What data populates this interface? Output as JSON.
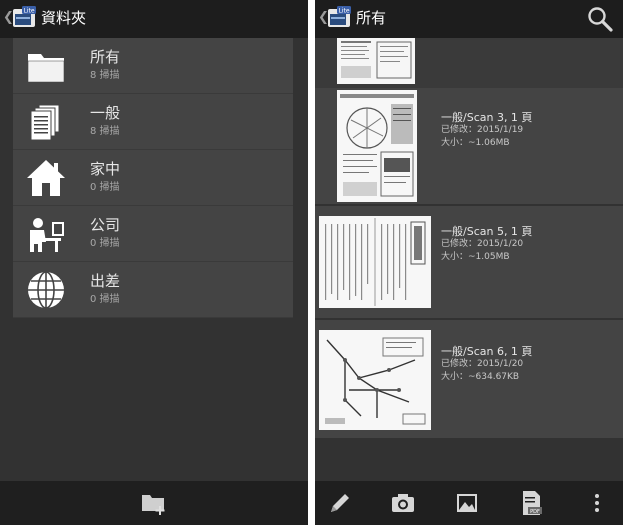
{
  "left_screen": {
    "title": "資料夾",
    "folders": [
      {
        "name": "所有",
        "count": "8 掃描",
        "icon": "folder-icon"
      },
      {
        "name": "一般",
        "count": "8 掃描",
        "icon": "documents-icon"
      },
      {
        "name": "家中",
        "count": "0 掃描",
        "icon": "home-icon"
      },
      {
        "name": "公司",
        "count": "0 掃描",
        "icon": "office-worker-icon"
      },
      {
        "name": "出差",
        "count": "0 掃描",
        "icon": "globe-icon"
      }
    ],
    "bottom_action": "new-folder-icon"
  },
  "right_screen": {
    "title": "所有",
    "scans": [
      {
        "title": "一般/Scan 3, 1 頁",
        "modified": "已修改：2015/1/19",
        "size": "大小：~1.06MB"
      },
      {
        "title": "一般/Scan 5, 1 頁",
        "modified": "已修改：2015/1/20",
        "size": "大小：~1.05MB"
      },
      {
        "title": "一般/Scan 6, 1 頁",
        "modified": "已修改：2015/1/20",
        "size": "大小：~634.67KB"
      }
    ],
    "toolbar": [
      "pencil-icon",
      "camera-icon",
      "gallery-icon",
      "pdf-icon",
      "overflow-menu-icon"
    ]
  },
  "colors": {
    "background": "#323232",
    "topbar": "#1d1d1d",
    "list_item": "#444444",
    "text_primary": "#e6e6e6",
    "text_secondary": "#a8a8a8"
  }
}
